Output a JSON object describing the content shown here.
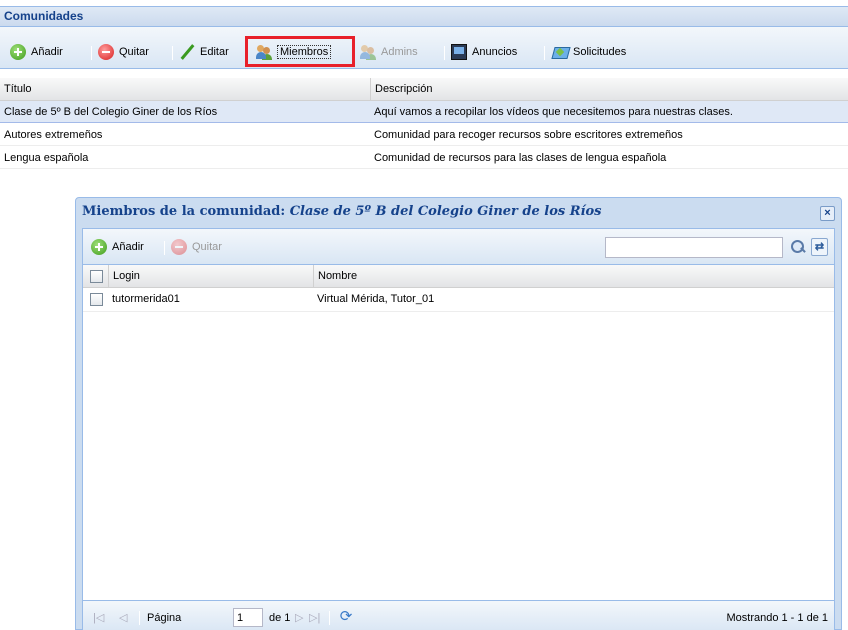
{
  "panel": {
    "title": "Comunidades"
  },
  "toolbar": {
    "add_label": "Añadir",
    "remove_label": "Quitar",
    "edit_label": "Editar",
    "members_label": "Miembros",
    "admins_label": "Admins",
    "announcements_label": "Anuncios",
    "requests_label": "Solicitudes"
  },
  "grid": {
    "columns": [
      "Título",
      "Descripción"
    ],
    "rows": [
      {
        "title": "Clase de 5º B del Colegio Giner de los Ríos",
        "description": "Aquí vamos a recopilar los vídeos que necesitemos para nuestras clases."
      },
      {
        "title": "Autores extremeños",
        "description": "Comunidad para recoger recursos sobre escritores extremeños"
      },
      {
        "title": "Lengua española",
        "description": "Comunidad de recursos para las clases de lengua española"
      }
    ]
  },
  "window": {
    "title_prefix": "Miembros de la comunidad:",
    "title_community": "Clase de 5º B del Colegio Giner de los Ríos",
    "close_label": "×",
    "toolbar": {
      "add_label": "Añadir",
      "remove_label": "Quitar",
      "search_value": ""
    },
    "grid": {
      "columns": [
        "Login",
        "Nombre"
      ],
      "rows": [
        {
          "login": "tutormerida01",
          "name": "Virtual Mérida, Tutor_01"
        }
      ]
    },
    "paging": {
      "first": "|◁",
      "prev": "◁",
      "page_label": "Página",
      "page_value": "1",
      "of_label": "de 1",
      "next": "▷",
      "last": "▷|",
      "info": "Mostrando 1 - 1 de 1"
    }
  },
  "colors": {
    "highlight": "#e8202a",
    "header_text": "#15428b",
    "selected_row": "#dfe8f6"
  }
}
